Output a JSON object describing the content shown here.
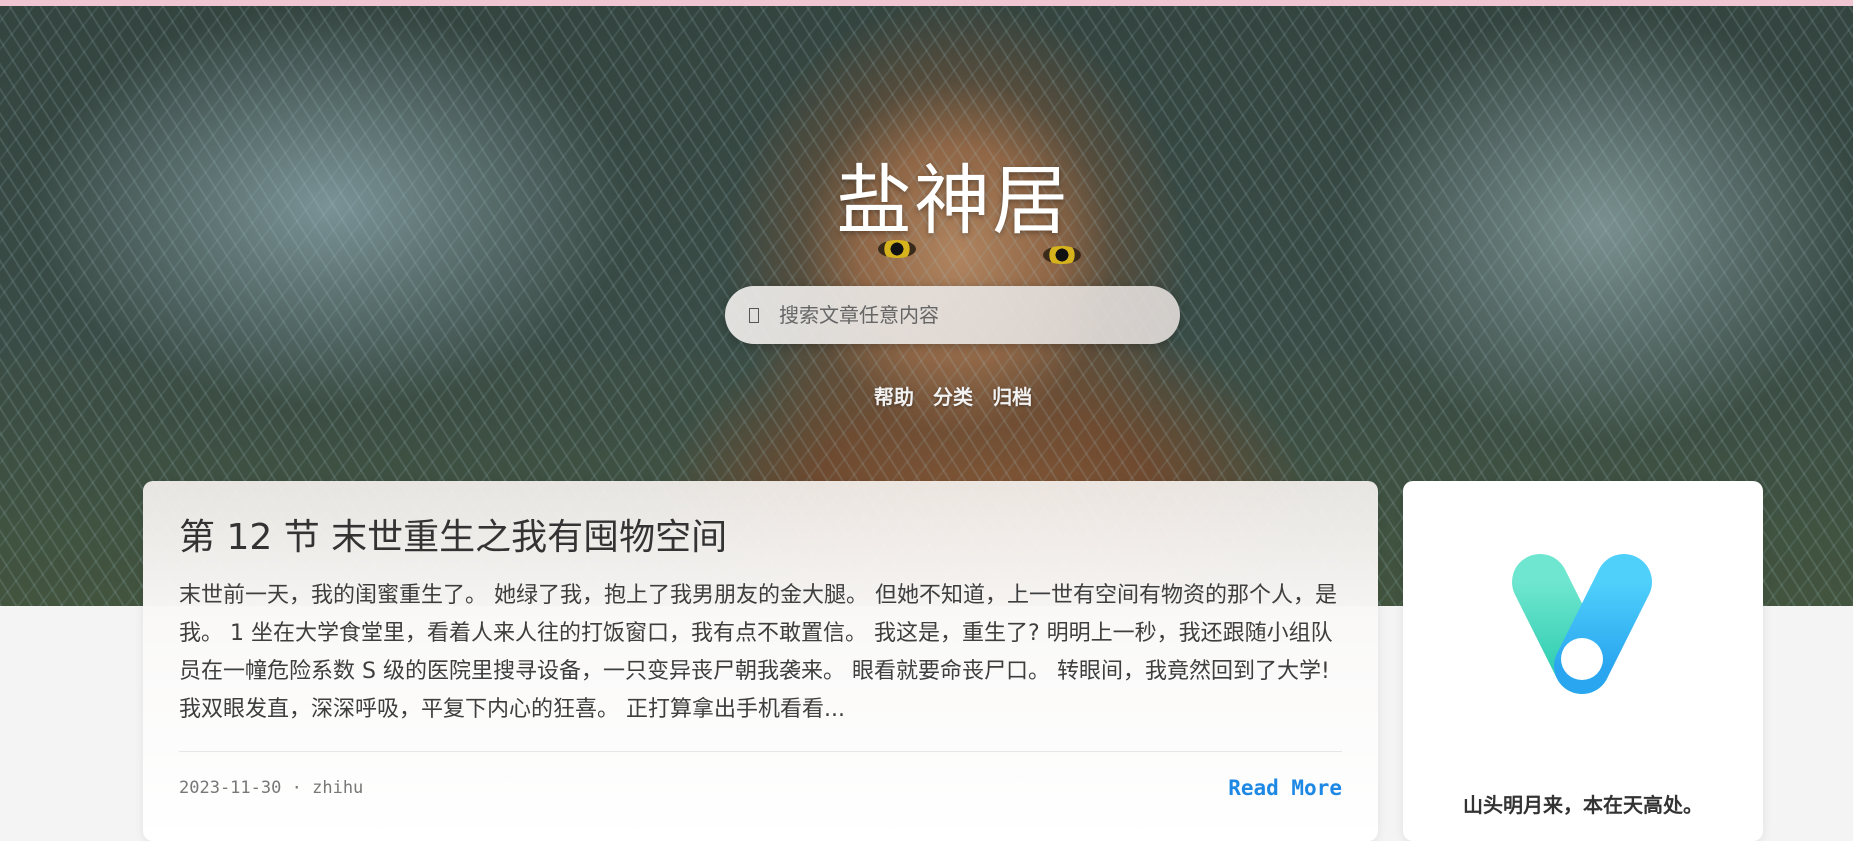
{
  "site": {
    "title": "盐神居"
  },
  "search": {
    "placeholder": "搜索文章任意内容"
  },
  "nav": {
    "items": [
      {
        "label": "帮助"
      },
      {
        "label": "分类"
      },
      {
        "label": "归档"
      }
    ]
  },
  "post": {
    "title": "第 12 节 末世重生之我有囤物空间",
    "excerpt": "末世前一天，我的闺蜜重生了。 她绿了我，抱上了我男朋友的金大腿。 但她不知道，上一世有空间有物资的那个人，是我。 1 坐在大学食堂里，看着人来人往的打饭窗口，我有点不敢置信。 我这是，重生了? 明明上一秒，我还跟随小组队员在一幢危险系数 S 级的医院里搜寻设备，一只变异丧尸朝我袭来。 眼看就要命丧尸口。 转眼间，我竟然回到了大学! 我双眼发直，深深呼吸，平复下内心的狂喜。 正打算拿出手机看看...",
    "date": "2023-11-30",
    "separator": "·",
    "author": "zhihu",
    "read_more": "Read More"
  },
  "profile": {
    "motto": "山头明月来，本在天高处。"
  },
  "icons": {
    "search": "search-icon",
    "logo": "v-logo"
  },
  "colors": {
    "accent": "#1e88e5",
    "top_bar": "#f0c6d2",
    "logo_teal": "#4fdcc1",
    "logo_blue": "#2fb4f5"
  }
}
